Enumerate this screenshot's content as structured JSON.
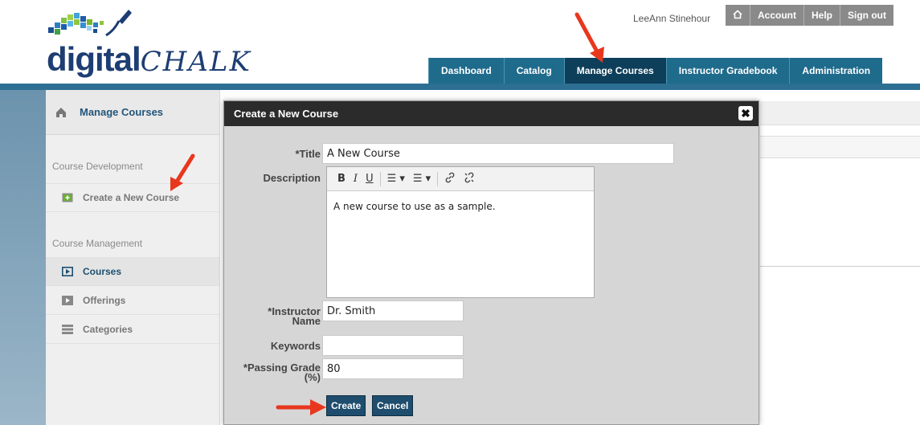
{
  "app": {
    "logo_text_bold": "digital",
    "logo_text_light": "CHALK"
  },
  "user": {
    "name": "LeeAnn Stinehour"
  },
  "topbar": {
    "home_icon": "home-icon",
    "account": "Account",
    "help": "Help",
    "sign_out": "Sign out"
  },
  "nav": {
    "tabs": [
      {
        "label": "Dashboard",
        "active": false
      },
      {
        "label": "Catalog",
        "active": false
      },
      {
        "label": "Manage Courses",
        "active": true
      },
      {
        "label": "Instructor Gradebook",
        "active": false
      },
      {
        "label": "Administration",
        "active": false
      }
    ]
  },
  "sidebar": {
    "title": "Manage Courses",
    "sections": [
      {
        "label": "Course Development"
      },
      {
        "label": "Course Management"
      }
    ],
    "items": [
      {
        "label": "Create a New Course",
        "icon": "add-course-icon"
      },
      {
        "label": "Courses",
        "icon": "play-box-icon"
      },
      {
        "label": "Offerings",
        "icon": "play-icon"
      },
      {
        "label": "Categories",
        "icon": "stack-icon"
      }
    ]
  },
  "modal": {
    "title": "Create a New Course",
    "close": "✖",
    "fields": {
      "title": {
        "label": "*Title",
        "value": "A New Course"
      },
      "description": {
        "label": "Description",
        "value": "A new course to use as a sample."
      },
      "instructor": {
        "label": "*Instructor Name",
        "value": "Dr. Smith"
      },
      "keywords": {
        "label": "Keywords",
        "value": ""
      },
      "passing_grade": {
        "label": "*Passing Grade (%)",
        "value": "80"
      }
    },
    "toolbar": {
      "bold": "B",
      "italic": "I",
      "underline": "U",
      "bullet_list": "☰ ▾",
      "numbered_list": "☰ ▾",
      "link": "🔗",
      "unlink": "⛓"
    },
    "buttons": {
      "create": "Create",
      "cancel": "Cancel"
    }
  },
  "colors": {
    "nav_tab": "#1f6b8c",
    "nav_tab_active": "#0d3f5a",
    "band": "#2c6f93",
    "modal_title_bg": "#2b2b2b",
    "button": "#1e4d6e",
    "annotation_arrow": "#e8371e"
  }
}
